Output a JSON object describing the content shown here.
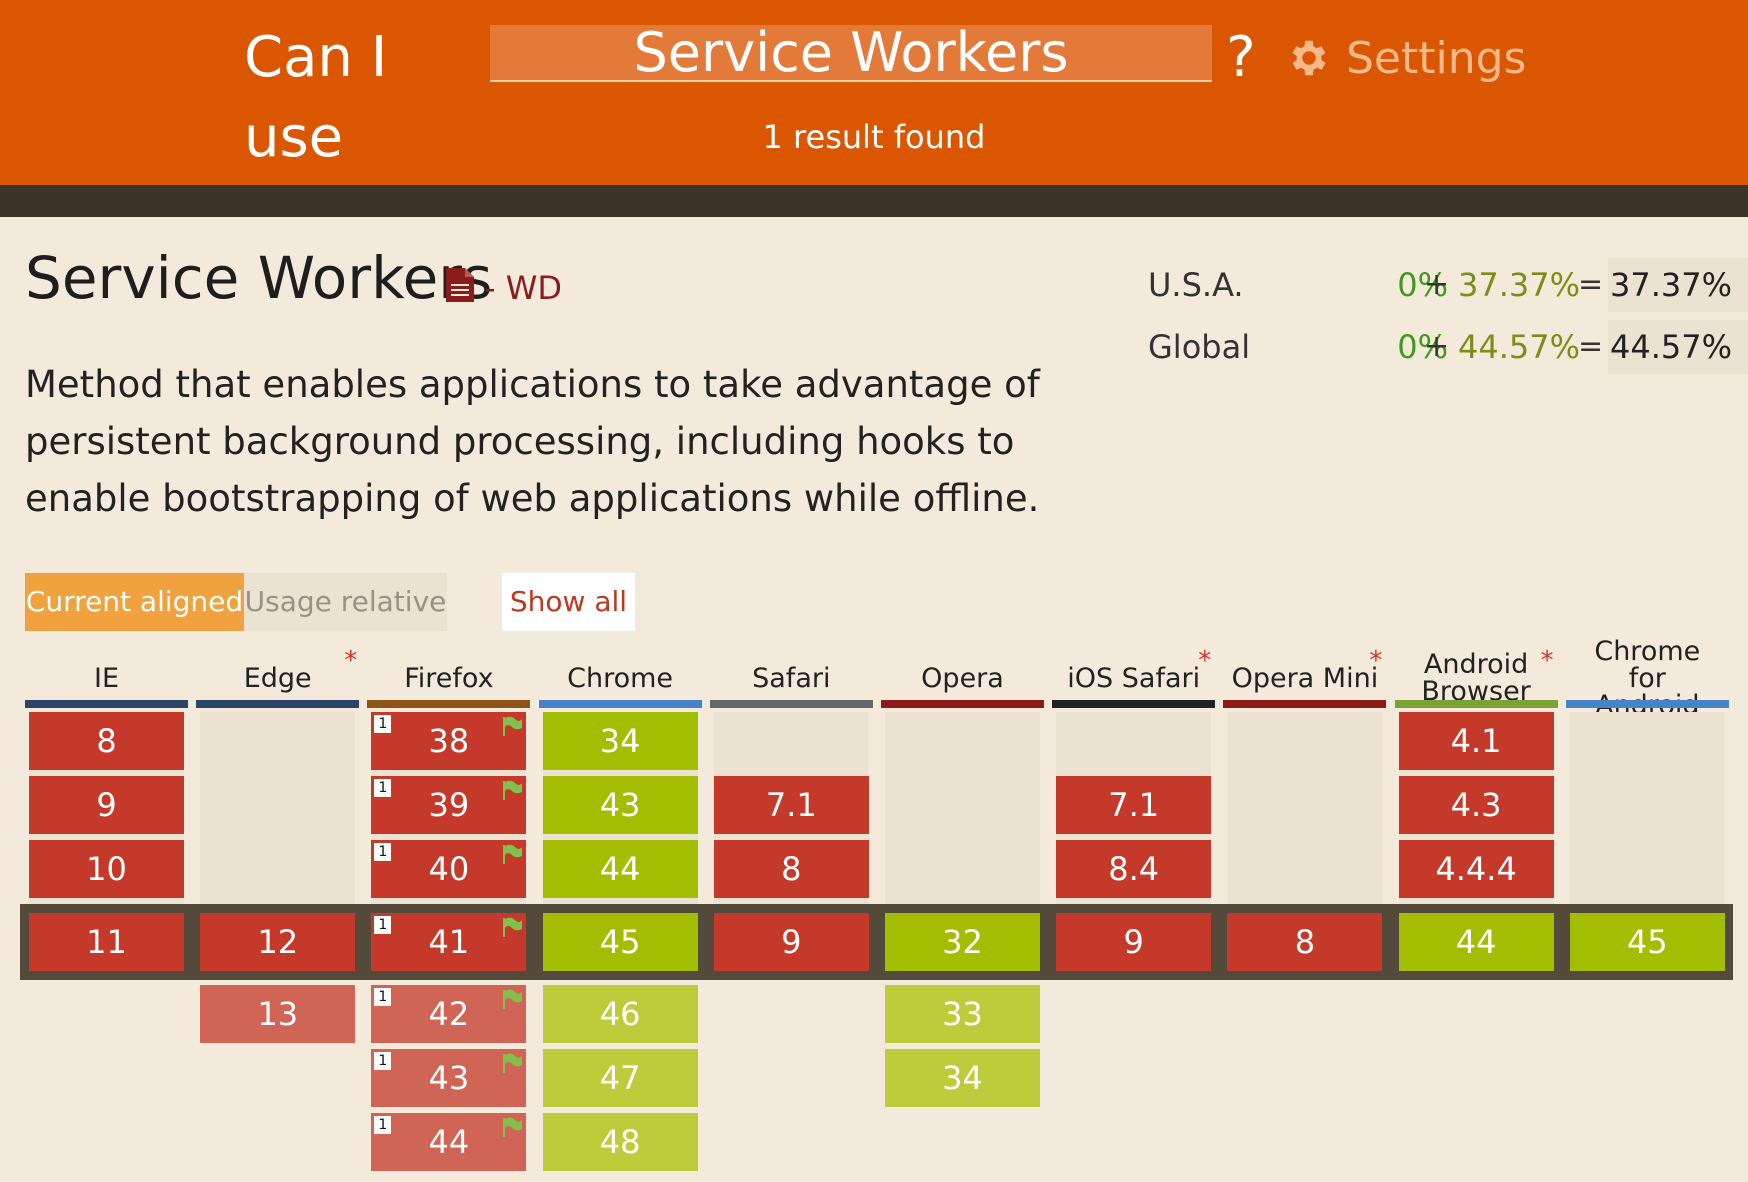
{
  "header": {
    "brand": "Can I use",
    "search_value": "Service Workers",
    "question_mark": "?",
    "settings_label": "Settings",
    "result_count": "1 result found"
  },
  "feature": {
    "title": "Service Workers",
    "status": "- WD",
    "description": "Method that enables applications to take advantage of persistent background processing, including hooks to enable bootstrapping of web applications while offline."
  },
  "usage": [
    {
      "label": "U.S.A.",
      "full": "0%",
      "plus": "+",
      "partial": "37.37%",
      "eq": "=",
      "total": "37.37%"
    },
    {
      "label": "Global",
      "full": "0%",
      "plus": "+",
      "partial": "44.57%",
      "eq": "=",
      "total": "44.57%"
    }
  ],
  "tabs": {
    "current": "Current aligned",
    "relative": "Usage relative",
    "show_all": "Show all"
  },
  "colors": {
    "header": "#db5600",
    "supported": "#a3bd00",
    "unsupported": "#c5392a",
    "tab_active": "#f0a23e"
  },
  "browsers": [
    {
      "name": "IE",
      "star": "",
      "bar_color": "#2b4468",
      "past": [
        "8",
        "9",
        "10"
      ],
      "current": "11",
      "future": [],
      "note": "",
      "flag": false
    },
    {
      "name": "Edge",
      "star": "*",
      "bar_color": "#2b4468",
      "past": [],
      "current": "12",
      "future": [
        "13"
      ],
      "note": "",
      "flag": false
    },
    {
      "name": "Firefox",
      "star": "",
      "bar_color": "#8c5417",
      "past": [
        "38",
        "39",
        "40"
      ],
      "current": "41",
      "future": [
        "42",
        "43",
        "44"
      ],
      "note": "1",
      "flag": true
    },
    {
      "name": "Chrome",
      "star": "",
      "bar_color": "#4684c8",
      "past": [
        "34",
        "43",
        "44"
      ],
      "current": "45",
      "future": [
        "46",
        "47",
        "48"
      ],
      "note": "",
      "flag": false
    },
    {
      "name": "Safari",
      "star": "",
      "bar_color": "#666666",
      "past": [
        "",
        "7.1",
        "8"
      ],
      "current": "9",
      "future": [],
      "note": "",
      "flag": false
    },
    {
      "name": "Opera",
      "star": "",
      "bar_color": "#8e1b1b",
      "past": [],
      "current": "32",
      "future": [
        "33",
        "34"
      ],
      "note": "",
      "flag": false
    },
    {
      "name": "iOS Safari",
      "star": "*",
      "bar_color": "#222222",
      "past": [
        "",
        "7.1",
        "8.4"
      ],
      "current": "9",
      "future": [],
      "note": "",
      "flag": false
    },
    {
      "name": "Opera Mini",
      "star": "*",
      "bar_color": "#8e1b1b",
      "past": [],
      "current": "8",
      "future": [],
      "note": "",
      "flag": false
    },
    {
      "name": "Android Browser",
      "star": "*",
      "bar_color": "#7aa334",
      "past": [
        "4.1",
        "4.3",
        "4.4.4"
      ],
      "current": "44",
      "future": [],
      "note": "",
      "flag": false
    },
    {
      "name": "Chrome for Android",
      "star": "",
      "bar_color": "#4684c8",
      "past": [],
      "current": "45",
      "future": [],
      "note": "",
      "flag": false
    }
  ]
}
